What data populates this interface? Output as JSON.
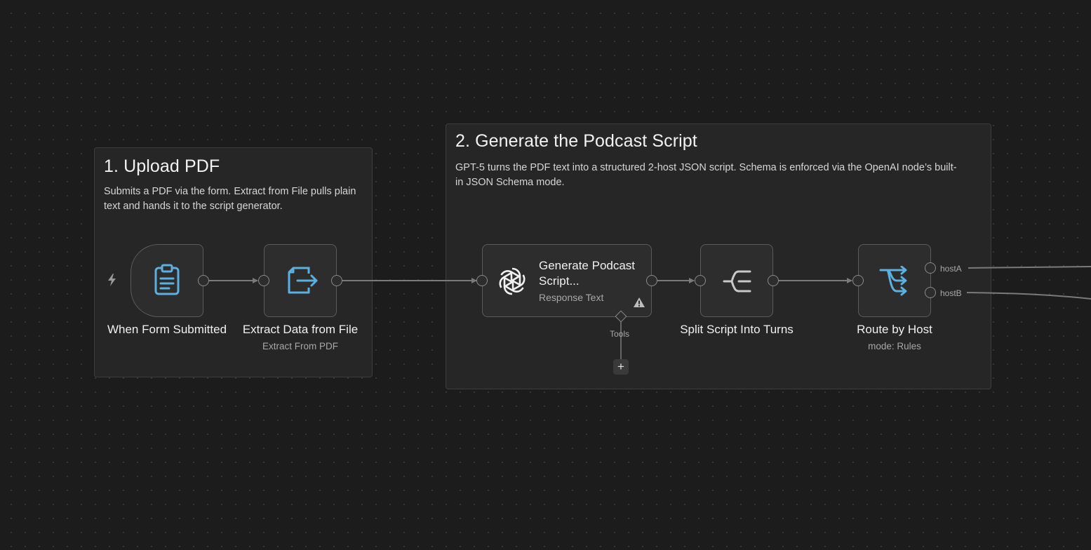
{
  "stickies": {
    "upload": {
      "title": "1. Upload PDF",
      "description": "Submits a PDF via the form. Extract from File pulls plain text and hands it to the script generator."
    },
    "generate": {
      "title": "2. Generate the Podcast Script",
      "description": "GPT-5 turns the PDF text into a structured 2-host JSON script. Schema is enforced via the OpenAI node’s built-in JSON Schema mode."
    }
  },
  "nodes": {
    "form_trigger": {
      "label": "When Form Submitted",
      "icon": "clipboard-icon"
    },
    "extract": {
      "label": "Extract Data from File",
      "subtitle": "Extract From PDF",
      "icon": "file-export-icon"
    },
    "generate_script": {
      "title": "Generate Podcast Script...",
      "subtitle": "Response Text",
      "icon": "openai-icon",
      "warning_icon": "warning-icon",
      "tools_label": "Tools",
      "add_tool_label": "+"
    },
    "split": {
      "label": "Split Script Into Turns",
      "icon": "split-out-icon"
    },
    "route": {
      "label": "Route by Host",
      "subtitle": "mode: Rules",
      "icon": "switch-icon",
      "outputs": [
        "hostA",
        "hostB"
      ]
    }
  },
  "colors": {
    "canvas": "#1c1c1c",
    "sticky": "#262626",
    "node": "#2d2d2d",
    "node_border": "#5b5b5b",
    "edge": "#7a7a7a",
    "icon_blue": "#5cb0e0",
    "icon_gray": "#c8c8c8"
  }
}
